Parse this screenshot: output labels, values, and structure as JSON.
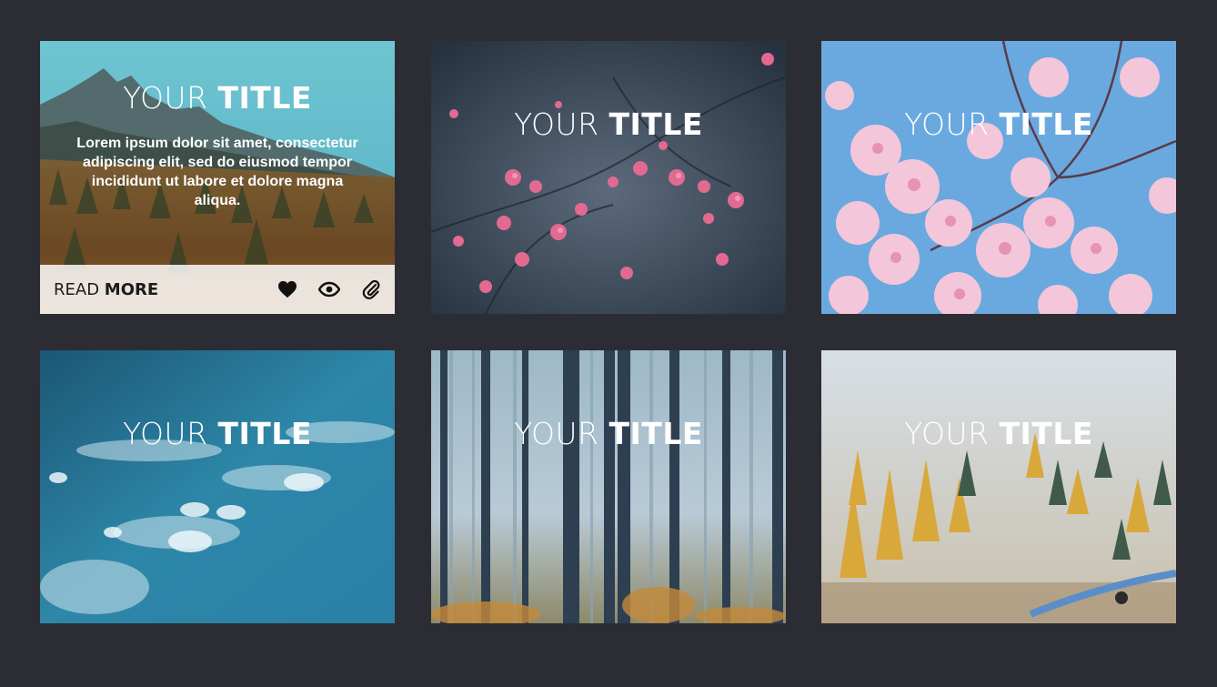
{
  "cards": [
    {
      "title_light": "YOUR",
      "title_bold": "TITLE",
      "description": "Lorem ipsum dolor sit amet, consectetur adipiscing elit, sed do eiusmod tempor incididunt ut labore et dolore magna aliqua.",
      "read_light": "READ",
      "read_bold": "MORE",
      "icons": [
        "heart-icon",
        "eye-icon",
        "paperclip-icon"
      ]
    },
    {
      "title_light": "YOUR",
      "title_bold": "TITLE"
    },
    {
      "title_light": "YOUR",
      "title_bold": "TITLE"
    },
    {
      "title_light": "YOUR",
      "title_bold": "TITLE"
    },
    {
      "title_light": "YOUR",
      "title_bold": "TITLE"
    },
    {
      "title_light": "YOUR",
      "title_bold": "TITLE"
    }
  ],
  "colors": {
    "page_background": "#2c2d34",
    "footer_background": "#ffffff"
  }
}
